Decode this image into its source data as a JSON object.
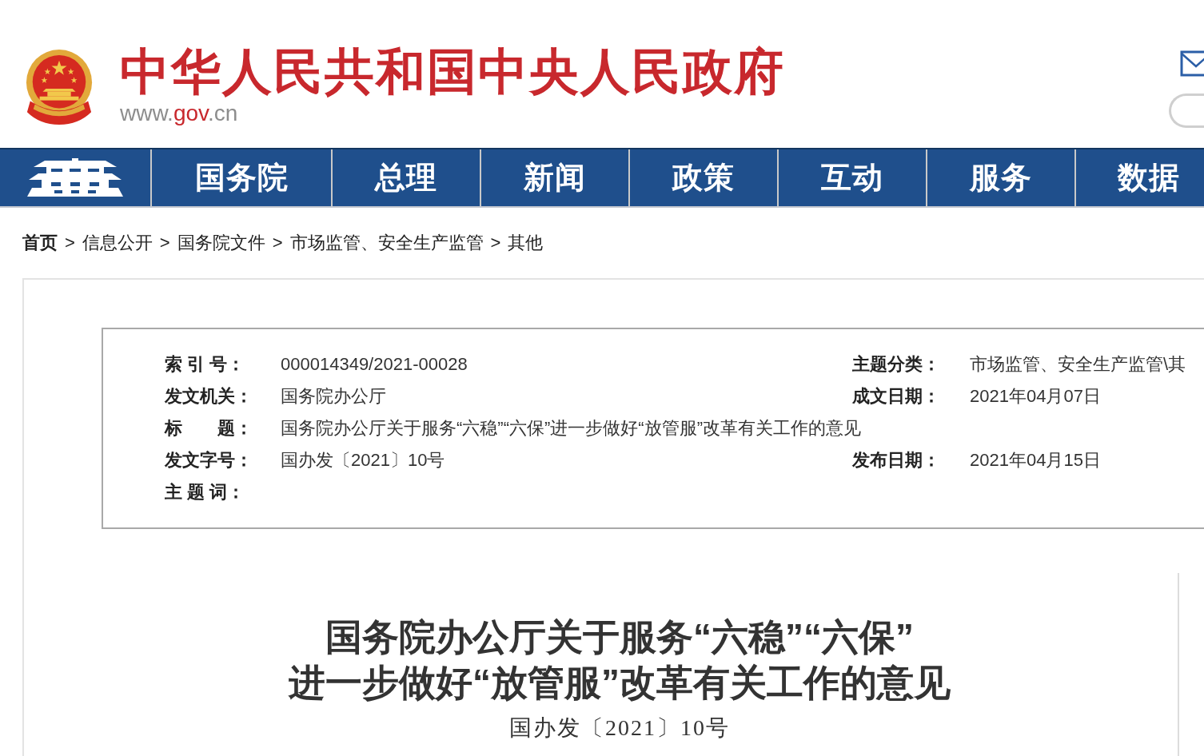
{
  "header": {
    "site_title": "中华人民共和国中央人民政府",
    "url": [
      {
        "text": "www.",
        "highlight": false
      },
      {
        "text": "gov",
        "highlight": true
      },
      {
        "text": ".cn",
        "highlight": false
      }
    ]
  },
  "nav": {
    "items": [
      "国务院",
      "总理",
      "新闻",
      "政策",
      "互动",
      "服务",
      "数据"
    ]
  },
  "breadcrumb": {
    "items": [
      "首页",
      "信息公开",
      "国务院文件",
      "市场监管、安全生产监管",
      "其他"
    ],
    "separators": [
      ">",
      ">",
      ">",
      ">"
    ]
  },
  "info_box": {
    "rows": [
      {
        "left": {
          "label": "索 引 号：",
          "value": "000014349/2021-00028"
        },
        "right": {
          "label": "主题分类：",
          "value": "市场监管、安全生产监管\\其"
        }
      },
      {
        "left": {
          "label": "发文机关：",
          "value": "国务院办公厅"
        },
        "right": {
          "label": "成文日期：",
          "value": "2021年04月07日"
        }
      },
      {
        "left": {
          "label": "标　　题：",
          "value": "国务院办公厅关于服务“六稳”“六保”进一步做好“放管服”改革有关工作的意见"
        }
      },
      {
        "left": {
          "label": "发文字号：",
          "value": "国办发〔2021〕10号"
        },
        "right": {
          "label": "发布日期：",
          "value": "2021年04月15日"
        }
      },
      {
        "left": {
          "label": "主 题 词："
        }
      }
    ]
  },
  "document": {
    "title": [
      "国务院办公厅关于服务“六稳”“六保”",
      "进一步做好“放管服”改革有关工作的意见"
    ],
    "number": "国办发〔2021〕10号"
  }
}
